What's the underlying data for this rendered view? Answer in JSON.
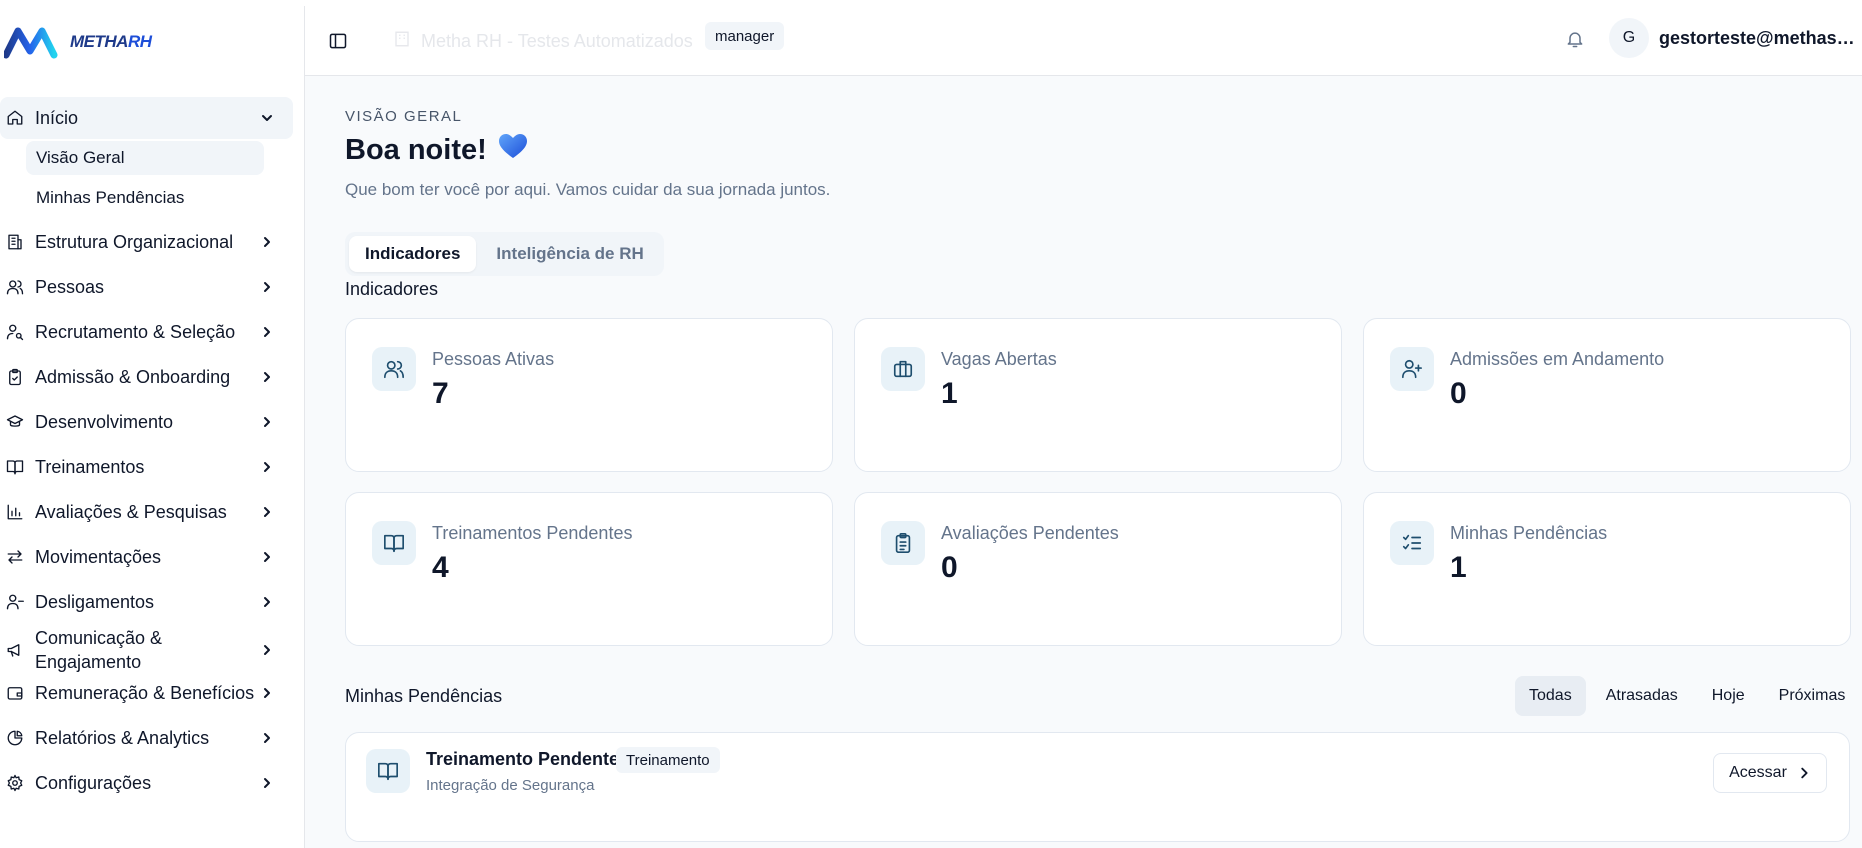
{
  "brand": {
    "logo_prefix": "METHA",
    "logo_suffix": "RH"
  },
  "header": {
    "workspace_name": "Metha RH - Testes Automatizados",
    "role": "manager",
    "avatar_initial": "G",
    "user_email": "gestorteste@methasol..."
  },
  "sidebar": {
    "items": [
      {
        "label": "Início",
        "icon": "home-icon",
        "expanded": true,
        "active": true,
        "children": [
          {
            "label": "Visão Geral",
            "active": true
          },
          {
            "label": "Minhas Pendências",
            "active": false
          }
        ]
      },
      {
        "label": "Estrutura Organizacional",
        "icon": "building-icon"
      },
      {
        "label": "Pessoas",
        "icon": "users-icon"
      },
      {
        "label": "Recrutamento & Seleção",
        "icon": "user-search-icon"
      },
      {
        "label": "Admissão & Onboarding",
        "icon": "clipboard-check-icon"
      },
      {
        "label": "Desenvolvimento",
        "icon": "graduation-cap-icon"
      },
      {
        "label": "Treinamentos",
        "icon": "book-open-icon"
      },
      {
        "label": "Avaliações & Pesquisas",
        "icon": "bar-chart-icon"
      },
      {
        "label": "Movimentações",
        "icon": "arrows-swap-icon"
      },
      {
        "label": "Desligamentos",
        "icon": "user-minus-icon"
      },
      {
        "label": "Comunicação & Engajamento",
        "icon": "megaphone-icon"
      },
      {
        "label": "Remuneração & Benefícios",
        "icon": "wallet-icon"
      },
      {
        "label": "Relatórios & Analytics",
        "icon": "pie-chart-icon"
      },
      {
        "label": "Configurações",
        "icon": "gear-icon"
      }
    ]
  },
  "main": {
    "eyebrow": "VISÃO GERAL",
    "greeting": "Boa noite!",
    "subtitle": "Que bom ter você por aqui. Vamos cuidar da sua jornada juntos.",
    "tabs": [
      {
        "label": "Indicadores",
        "active": true
      },
      {
        "label": "Inteligência de RH",
        "active": false
      }
    ],
    "section_title": "Indicadores",
    "cards": [
      {
        "label": "Pessoas Ativas",
        "value": "7",
        "icon": "users-icon"
      },
      {
        "label": "Vagas Abertas",
        "value": "1",
        "icon": "briefcase-icon"
      },
      {
        "label": "Admissões em Andamento",
        "value": "0",
        "icon": "user-plus-icon"
      },
      {
        "label": "Treinamentos Pendentes",
        "value": "4",
        "icon": "book-open-icon"
      },
      {
        "label": "Avaliações Pendentes",
        "value": "0",
        "icon": "clipboard-list-icon"
      },
      {
        "label": "Minhas Pendências",
        "value": "1",
        "icon": "list-checks-icon"
      }
    ],
    "pendencias": {
      "title": "Minhas Pendências",
      "filters": [
        {
          "label": "Todas",
          "active": true
        },
        {
          "label": "Atrasadas",
          "active": false
        },
        {
          "label": "Hoje",
          "active": false
        },
        {
          "label": "Próximas",
          "active": false
        }
      ],
      "items": [
        {
          "title": "Treinamento Pendente",
          "badge": "Treinamento",
          "subtitle": "Integração de Segurança",
          "action": "Acessar",
          "icon": "book-open-icon"
        }
      ]
    }
  },
  "colors": {
    "accent": "#1e4e6e",
    "icon_bg": "#e8f2f8",
    "heart": "#2563eb"
  }
}
